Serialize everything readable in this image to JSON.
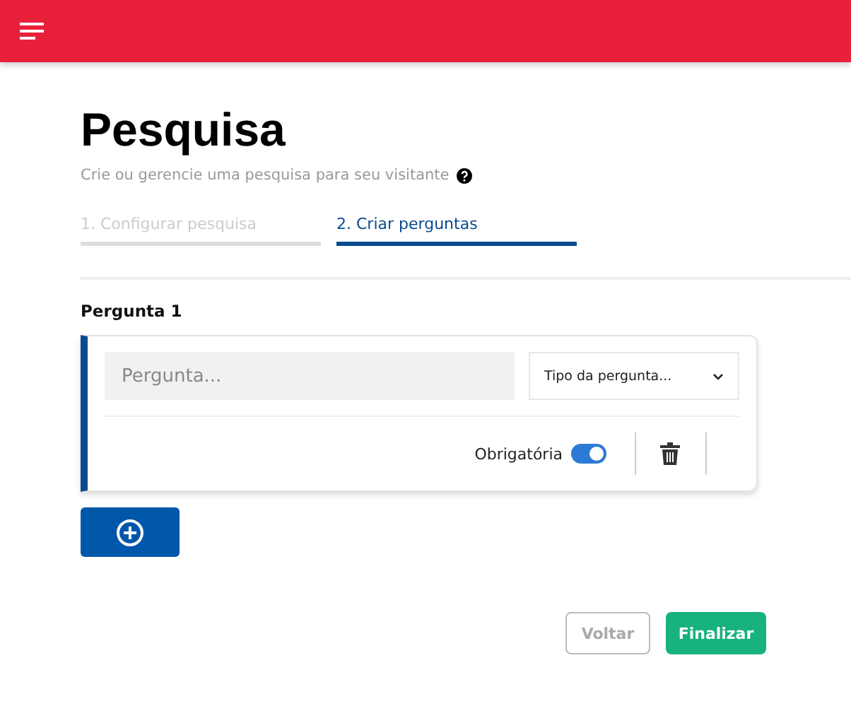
{
  "page": {
    "title": "Pesquisa",
    "subtitle": "Crie ou gerencie uma pesquisa para seu visitante"
  },
  "steps": [
    {
      "label": "1. Configurar pesquisa",
      "selected": false
    },
    {
      "label": "2. Criar perguntas",
      "selected": true
    }
  ],
  "questions": [
    {
      "heading": "Pergunta 1",
      "placeholder": "Pergunta...",
      "type_select": "Tipo da pergunta...",
      "required_label": "Obrigatória",
      "required": true
    }
  ],
  "buttons": {
    "back": "Voltar",
    "finish": "Finalizar"
  }
}
